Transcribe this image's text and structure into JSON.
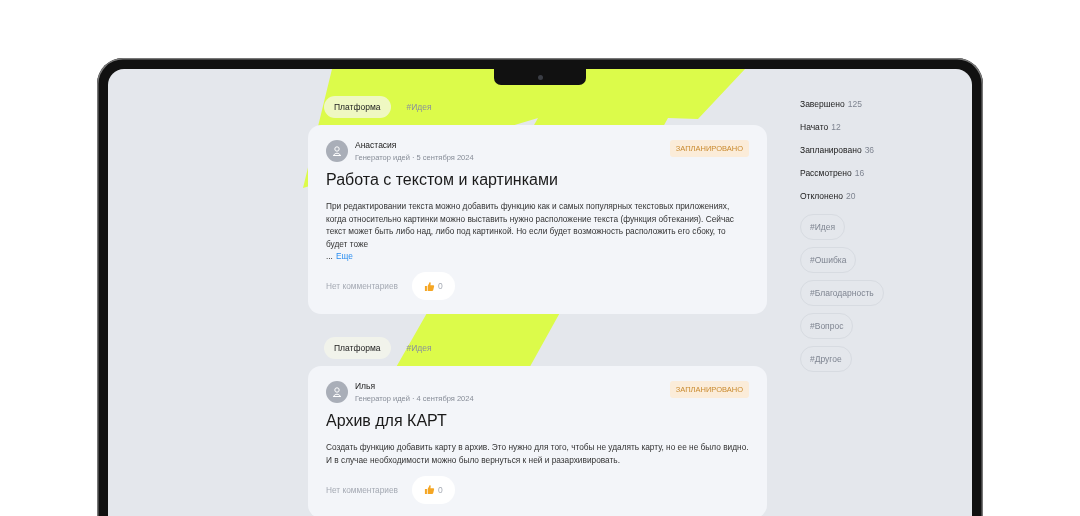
{
  "feed": [
    {
      "category": "Платформа",
      "hashtag": "#Идея",
      "post": {
        "author": "Анастасия",
        "meta": "Генератор идей · 5 сентября 2024",
        "status": "ЗАПЛАНИРОВАНО",
        "title": "Работа с текстом и картинками",
        "body": "При редактировании текста можно добавить функцию как и самых популярных текстовых приложениях, когда относительно картинки можно выставить нужно расположение текста (функция обтекания). Сейчас текст может быть либо над, либо под картинкой. Но если будет возможность расположить его сбоку, то будет тоже",
        "ellipsis": "...",
        "more": "Еще",
        "comments": "Нет комментариев",
        "likes": "0"
      }
    },
    {
      "category": "Платформа",
      "hashtag": "#Идея",
      "post": {
        "author": "Илья",
        "meta": "Генератор идей · 4 сентября 2024",
        "status": "ЗАПЛАНИРОВАНО",
        "title": "Архив для КАРТ",
        "body": "Создать функцию добавить карту в архив. Это нужно для того, чтобы не удалять карту, но ее не было видно. И в случае необходимости можно было вернуться к ней и разархивировать.",
        "comments": "Нет комментариев",
        "likes": "0"
      }
    }
  ],
  "sidebar": {
    "statuses": [
      {
        "label": "Завершено",
        "count": "125"
      },
      {
        "label": "Начато",
        "count": "12"
      },
      {
        "label": "Запланировано",
        "count": "36"
      },
      {
        "label": "Рассмотрено",
        "count": "16"
      },
      {
        "label": "Отклонено",
        "count": "20"
      }
    ],
    "hashtags": [
      "#Идея",
      "#Ошибка",
      "#Благодарность",
      "#Вопрос",
      "#Другое"
    ]
  }
}
